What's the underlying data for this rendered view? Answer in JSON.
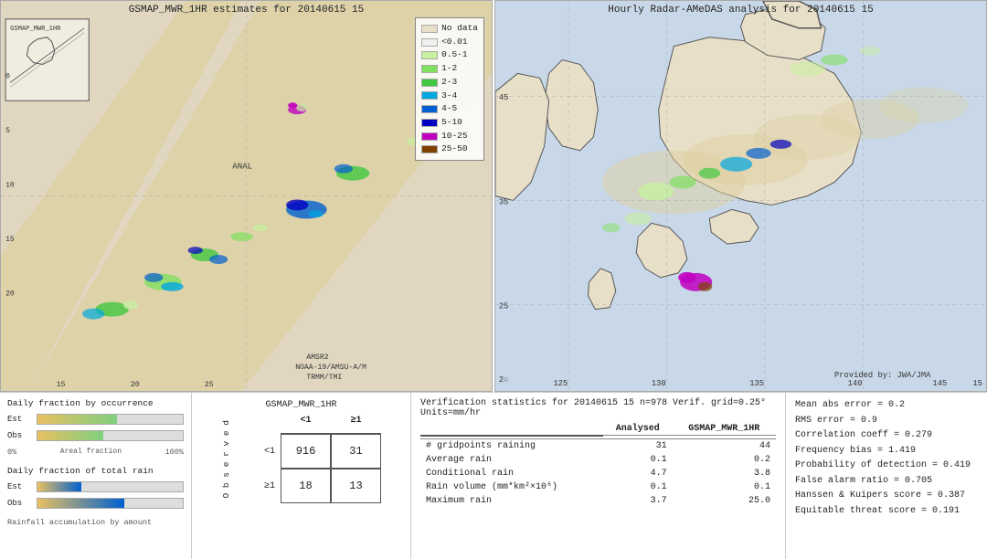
{
  "map1": {
    "title": "GSMAP_MWR_1HR estimates for 20140615 15",
    "credit_lines": [
      "AMSR2",
      "NOAA-19/AMSU-A/M",
      "TRMM/TMI"
    ],
    "inset_label": "GSMAP_MWR_1HR",
    "anal_label": "ANAL"
  },
  "map2": {
    "title": "Hourly Radar-AMeDAS analysis for 20140615 15",
    "credit": "Provided by: JWA/JMA",
    "lat_labels": [
      "45",
      "35",
      "25"
    ],
    "lon_labels": [
      "125",
      "130",
      "135",
      "140",
      "145",
      "15"
    ]
  },
  "legend": {
    "title": "No data",
    "items": [
      {
        "label": "No data",
        "color": "#e8dfc8"
      },
      {
        "label": "<0.01",
        "color": "#f0f0f0"
      },
      {
        "label": "0.5-1",
        "color": "#c8f0a0"
      },
      {
        "label": "1-2",
        "color": "#80e060"
      },
      {
        "label": "2-3",
        "color": "#40c840"
      },
      {
        "label": "3-4",
        "color": "#00a8e0"
      },
      {
        "label": "4-5",
        "color": "#0060d0"
      },
      {
        "label": "5-10",
        "color": "#0000c0"
      },
      {
        "label": "10-25",
        "color": "#c000c0"
      },
      {
        "label": "25-50",
        "color": "#804000"
      }
    ]
  },
  "charts": {
    "occurrence_title": "Daily fraction by occurrence",
    "total_title": "Daily fraction of total rain",
    "amount_label": "Rainfall accumulation by amount",
    "est_label": "Est",
    "obs_label": "Obs",
    "est_occurrence_pct": 55,
    "obs_occurrence_pct": 45,
    "est_rain_pct": 30,
    "obs_rain_pct": 60,
    "axis_left": "0%",
    "axis_right": "100%",
    "axis_label": "Areal fraction"
  },
  "contingency": {
    "title": "GSMAP_MWR_1HR",
    "col_headers": [
      "<1",
      "≥1"
    ],
    "row_headers": [
      "<1",
      "≥1"
    ],
    "obs_label": "O b s e r v e d",
    "cells": [
      [
        "916",
        "31"
      ],
      [
        "18",
        "13"
      ]
    ]
  },
  "verification": {
    "title": "Verification statistics for 20140615 15  n=978  Verif. grid=0.25°  Units=mm/hr",
    "col_headers": [
      "Analysed",
      "GSMAP_MWR_1HR"
    ],
    "rows": [
      {
        "label": "# gridpoints raining",
        "val1": "31",
        "val2": "44"
      },
      {
        "label": "Average rain",
        "val1": "0.1",
        "val2": "0.2"
      },
      {
        "label": "Conditional rain",
        "val1": "4.7",
        "val2": "3.8"
      },
      {
        "label": "Rain volume (mm*km²×10⁶)",
        "val1": "0.1",
        "val2": "0.1"
      },
      {
        "label": "Maximum rain",
        "val1": "3.7",
        "val2": "25.0"
      }
    ]
  },
  "scalar_stats": {
    "items": [
      "Mean abs error = 0.2",
      "RMS error = 0.9",
      "Correlation coeff = 0.279",
      "Frequency bias = 1.419",
      "Probability of detection = 0.419",
      "False alarm ratio = 0.705",
      "Hanssen & Kuipers score = 0.387",
      "Equitable threat score = 0.191"
    ]
  }
}
